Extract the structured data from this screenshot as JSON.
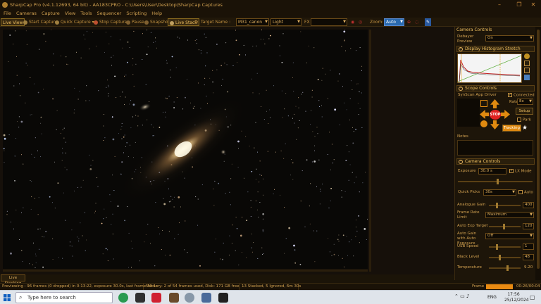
{
  "window": {
    "title": "SharpCap Pro (v4.1.12693, 64 bit) - AA183CPRO - C:\\Users\\User\\Desktop\\SharpCap Captures"
  },
  "menu": [
    "File",
    "Cameras",
    "Capture",
    "View",
    "Tools",
    "Sequencer",
    "Scripting",
    "Help"
  ],
  "toolbar": {
    "live_view": "Live View",
    "start_capture": "Start Capture",
    "quick_capture": "Quick Capture",
    "stop_capture": "Stop Capture",
    "pause": "Pause",
    "snapshot": "Snapshot",
    "live_stack": "Live Stack",
    "target_name_label": "Target Name :",
    "target_name_value": "M31_canon",
    "frame_type": "Light",
    "fx_label": "FX",
    "fx_value": "",
    "zoom_label": "Zoom:",
    "zoom_value": "Auto"
  },
  "panel": {
    "camera_controls_tab": "Camera Controls",
    "debayer_label": "Debayer Preview",
    "debayer_value": "On",
    "histogram_title": "Display Histogram Stretch",
    "scope_title": "Scope Controls",
    "scope_driver": "SynScan App Driver",
    "connected_label": "Connected",
    "rate_label": "Rate:",
    "rate_value": "8x",
    "stop_label": "STOP",
    "setup_label": "Setup",
    "park_label": "Park",
    "tracking_label": "Tracking",
    "notes_label": "Notes",
    "camera_title": "Camera Controls",
    "exposure_label": "Exposure",
    "exposure_value": "30.0 s",
    "lx_mode_label": "LX Mode",
    "quick_picks_label": "Quick Picks",
    "quick_picks_value": "30s",
    "auto_label": "Auto",
    "analogue_gain_label": "Analogue Gain",
    "analogue_gain_value": "400",
    "frame_rate_label": "Frame Rate Limit",
    "frame_rate_value": "Maximum",
    "auto_exp_label": "Auto Exp Target",
    "auto_exp_value": "120",
    "auto_gain_label": "Auto Gain with Auto Exposure",
    "auto_gain_value": "Off",
    "usb_speed_label": "USB Speed",
    "usb_speed_value": "1",
    "black_level_label": "Black Level",
    "black_level_value": "48",
    "temperature_label": "Temperature",
    "temperature_value": "9.20"
  },
  "status": {
    "live_stacking": "Live Stacking",
    "previewing": "Previewing : 96 frames (0 dropped) in 0:13:22, exposure 30.0s, last frame 30.1s",
    "memory": "Memory: 2 of 54 frames used, Disk: 171 GB free",
    "stacked": "13 Stacked, 5 Ignored, 6m 30s",
    "frame_label": "Frame",
    "frame_progress": 1.0,
    "frame_time": "00:26/00:04"
  },
  "taskbar": {
    "search_placeholder": "Type here to search",
    "lang": "ENG",
    "time": "17:56",
    "date": "25/12/2024"
  },
  "colors": {
    "accent": "#e88a12",
    "panel_bg": "#1d1509",
    "text": "#e0b060",
    "stop": "#e02020"
  }
}
